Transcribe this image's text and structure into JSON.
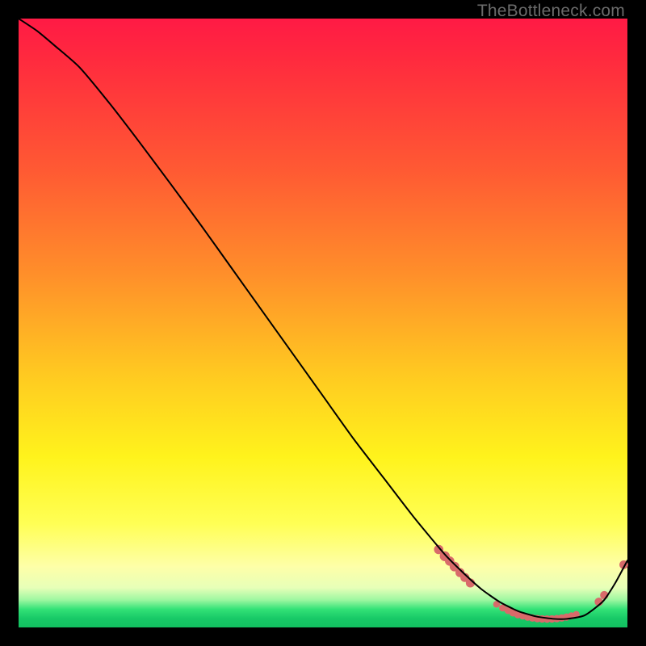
{
  "watermark": "TheBottleneck.com",
  "chart_data": {
    "type": "line",
    "title": "",
    "xlabel": "",
    "ylabel": "",
    "xlim": [
      0,
      100
    ],
    "ylim": [
      0,
      100
    ],
    "series": [
      {
        "name": "curve",
        "x": [
          0,
          3,
          6,
          10,
          15,
          20,
          25,
          30,
          35,
          40,
          45,
          50,
          55,
          60,
          65,
          70,
          73,
          76,
          79,
          82,
          85,
          88,
          90,
          93,
          96,
          98,
          100
        ],
        "y": [
          100,
          98,
          95.5,
          92,
          86,
          79.5,
          72.8,
          66,
          59,
          52,
          45,
          38,
          31,
          24.5,
          18,
          12,
          9,
          6.3,
          4.2,
          2.7,
          1.8,
          1.4,
          1.4,
          2.0,
          4.3,
          7.3,
          11.0
        ]
      }
    ],
    "markers": {
      "name": "highlight-points",
      "color": "#d86a6a",
      "points": [
        {
          "x": 69.0,
          "y": 12.8,
          "r": 5.8
        },
        {
          "x": 70.0,
          "y": 11.7,
          "r": 6.2
        },
        {
          "x": 70.8,
          "y": 10.9,
          "r": 5.8
        },
        {
          "x": 71.6,
          "y": 10.0,
          "r": 6.0
        },
        {
          "x": 72.5,
          "y": 9.0,
          "r": 5.6
        },
        {
          "x": 73.3,
          "y": 8.2,
          "r": 5.6
        },
        {
          "x": 74.2,
          "y": 7.3,
          "r": 5.6
        },
        {
          "x": 78.5,
          "y": 3.8,
          "r": 4.2
        },
        {
          "x": 79.5,
          "y": 3.2,
          "r": 4.4
        },
        {
          "x": 80.4,
          "y": 2.8,
          "r": 4.6
        },
        {
          "x": 81.2,
          "y": 2.4,
          "r": 4.6
        },
        {
          "x": 82.0,
          "y": 2.1,
          "r": 4.6
        },
        {
          "x": 82.8,
          "y": 1.9,
          "r": 4.6
        },
        {
          "x": 83.6,
          "y": 1.7,
          "r": 4.6
        },
        {
          "x": 84.4,
          "y": 1.55,
          "r": 4.6
        },
        {
          "x": 85.2,
          "y": 1.45,
          "r": 4.6
        },
        {
          "x": 86.0,
          "y": 1.4,
          "r": 4.6
        },
        {
          "x": 86.8,
          "y": 1.38,
          "r": 4.6
        },
        {
          "x": 87.6,
          "y": 1.4,
          "r": 4.6
        },
        {
          "x": 88.4,
          "y": 1.45,
          "r": 4.6
        },
        {
          "x": 89.2,
          "y": 1.55,
          "r": 4.6
        },
        {
          "x": 90.0,
          "y": 1.7,
          "r": 4.6
        },
        {
          "x": 90.8,
          "y": 1.9,
          "r": 4.4
        },
        {
          "x": 91.6,
          "y": 2.15,
          "r": 4.2
        },
        {
          "x": 95.3,
          "y": 4.2,
          "r": 5.2
        },
        {
          "x": 96.2,
          "y": 5.3,
          "r": 5.2
        },
        {
          "x": 99.4,
          "y": 10.3,
          "r": 5.4
        }
      ]
    }
  }
}
